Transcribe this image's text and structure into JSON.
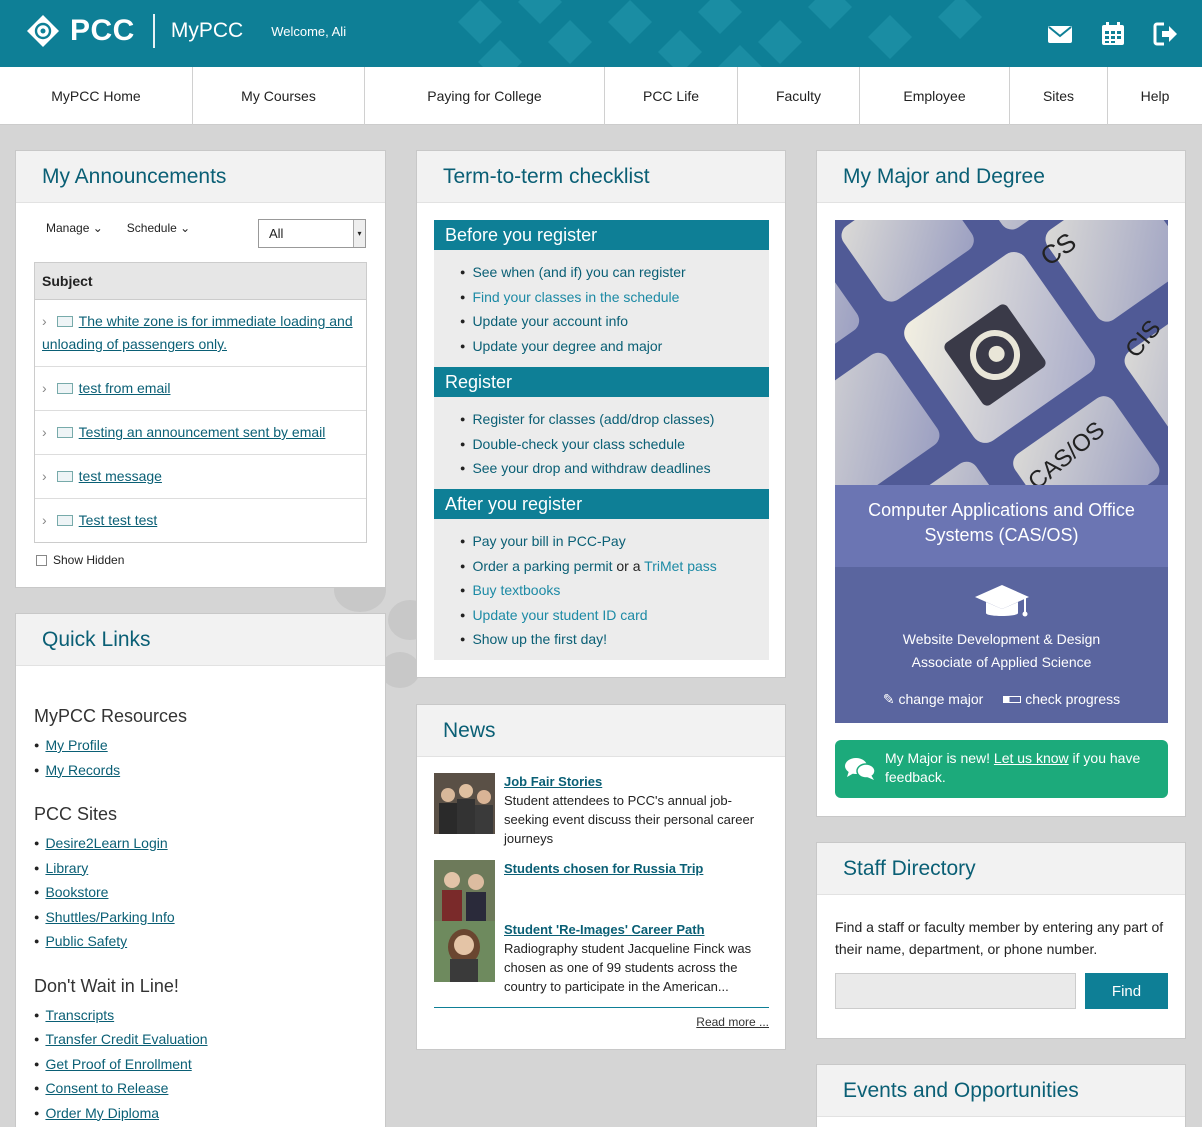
{
  "header": {
    "brand": "PCC",
    "app_name": "MyPCC",
    "welcome": "Welcome, Ali",
    "colors": {
      "header_bg": "#0e7f96",
      "accent": "#0e7f96",
      "success": "#1caa7b",
      "major_purple": "#6b75b3"
    }
  },
  "nav": {
    "items": [
      "MyPCC Home",
      "My Courses",
      "Paying for College",
      "PCC Life",
      "Faculty",
      "Employee",
      "Sites",
      "Help"
    ]
  },
  "announcements": {
    "title": "My Announcements",
    "manage_label": "Manage",
    "schedule_label": "Schedule",
    "filter_value": "All",
    "column_subject": "Subject",
    "items": [
      "The white zone is for immediate loading and unloading of passengers only.",
      "test from email",
      "Testing an announcement sent by email",
      "test message",
      "Test test test"
    ],
    "show_hidden_label": "Show Hidden"
  },
  "quick_links": {
    "title": "Quick Links",
    "groups": [
      {
        "heading": "MyPCC Resources",
        "links": [
          "My Profile",
          "My Records"
        ]
      },
      {
        "heading": "PCC Sites",
        "links": [
          "Desire2Learn Login",
          "Library",
          "Bookstore",
          "Shuttles/Parking Info",
          "Public Safety"
        ]
      },
      {
        "heading": "Don't Wait in Line!",
        "links": [
          "Transcripts",
          "Transfer Credit Evaluation",
          "Get Proof of Enrollment",
          "Consent to Release",
          "Order My Diploma"
        ]
      }
    ]
  },
  "checklist": {
    "title": "Term-to-term checklist",
    "sections": [
      {
        "heading": "Before you register",
        "items": [
          "See when (and if) you can register",
          "Find your classes in the schedule",
          "Update your account info",
          "Update your degree and major"
        ]
      },
      {
        "heading": "Register",
        "items": [
          "Register for classes (add/drop classes)",
          "Double-check your class schedule",
          "See your drop and withdraw deadlines"
        ]
      },
      {
        "heading": "After you register",
        "items": [
          "Pay your bill in PCC-Pay",
          "Order a parking permit",
          "or a",
          "TriMet pass",
          "Buy textbooks",
          "Update your student ID card",
          "Show up the first day!"
        ]
      }
    ]
  },
  "news": {
    "title": "News",
    "items": [
      {
        "title": "Job Fair Stories",
        "text": "Student attendees to PCC's annual job-seeking event discuss their personal career journeys"
      },
      {
        "title": "Students chosen for Russia Trip",
        "text": ""
      },
      {
        "title": "Student 'Re-Images' Career Path",
        "text": "Radiography student Jacqueline Finck was chosen as one of 99 students across the country to participate in the American..."
      }
    ],
    "read_more": "Read more ..."
  },
  "major": {
    "title": "My Major and Degree",
    "image_keys": [
      "CS",
      "CIS",
      "CAS/OS"
    ],
    "program": "Computer Applications and Office Systems (CAS/OS)",
    "degree_line1": "Website Development & Design",
    "degree_line2": "Associate of Applied Science",
    "change_major": "change major",
    "check_progress": "check progress",
    "feedback_pre": "My Major is new!",
    "feedback_link": "Let us know",
    "feedback_post": "if you have feedback."
  },
  "staff": {
    "title": "Staff Directory",
    "description": "Find a staff or faculty member by entering any part of their name, department, or phone number.",
    "search_placeholder": "",
    "find_label": "Find"
  },
  "events": {
    "title": "Events and Opportunities"
  }
}
